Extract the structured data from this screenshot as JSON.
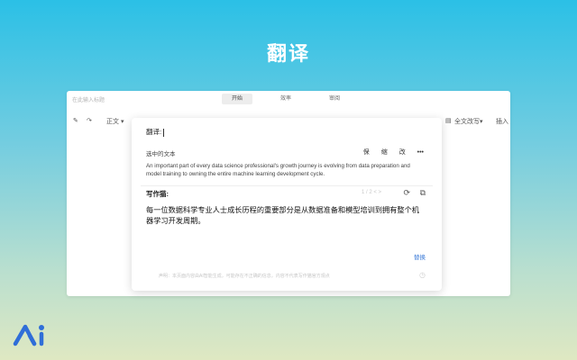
{
  "hero": {
    "title": "翻译"
  },
  "window": {
    "doc_name": "在此输入标题",
    "tabs": [
      {
        "label": "开始"
      },
      {
        "label": "效率"
      },
      {
        "label": "审阅"
      }
    ],
    "toolbar": {
      "text_style": "正文 ▾",
      "full_text_translate": "全文改写▾",
      "insert": "插入"
    }
  },
  "popup": {
    "translate_label": "翻译:",
    "selected_title": "选中的文本",
    "actions": [
      {
        "label": "保"
      },
      {
        "label": "缩"
      },
      {
        "label": "改"
      },
      {
        "label": "•••"
      }
    ],
    "selected_text": "An important part of every data science professional's growth journey is evolving from data preparation and model training to owning the entire machine learning development cycle.",
    "writer_label": "写作猫:",
    "counter": "1 / 2 < >",
    "result_text": "每一位数据科学专业人士成长历程的重要部分是从数据准备和模型培训到拥有整个机器学习开发周期。",
    "replace_label": "替换",
    "footer_note": "声明：本页面内容由AI智能生成，可能存在不正确的信息，内容不代表写作猫官方观点",
    "refresh_icon": "refresh-icon",
    "copy_icon": "copy-icon",
    "clock_icon": "clock-icon"
  },
  "colors": {
    "accent": "#3b7bd8",
    "logo": "#2f6ed8"
  }
}
